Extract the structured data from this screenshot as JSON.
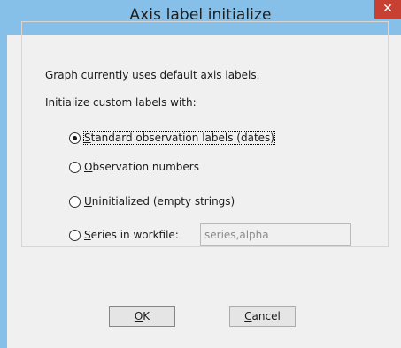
{
  "window": {
    "title": "Axis label initialize",
    "close_glyph": "✕"
  },
  "content": {
    "description": "Graph currently uses default axis labels.",
    "prompt": "Initialize custom labels with:"
  },
  "options": [
    {
      "key": "S",
      "rest": "tandard observation labels (dates)",
      "checked": true
    },
    {
      "key": "O",
      "rest": "bservation numbers",
      "checked": false
    },
    {
      "key": "U",
      "rest": "ninitialized (empty strings)",
      "checked": false
    },
    {
      "key": "S",
      "rest": "eries in workfile:",
      "checked": false
    }
  ],
  "series_input": {
    "value": "series,alpha",
    "enabled": false
  },
  "buttons": {
    "ok_key": "O",
    "ok_rest": "K",
    "cancel_key": "C",
    "cancel_rest": "ancel"
  },
  "colors": {
    "titlebar": "#86bfe8",
    "close_button": "#c84031",
    "dialog_background": "#f0f0f0",
    "default_button_border": "#3399ff"
  },
  "icons": [
    "close-icon",
    "radio-checked",
    "radio-unchecked"
  ]
}
